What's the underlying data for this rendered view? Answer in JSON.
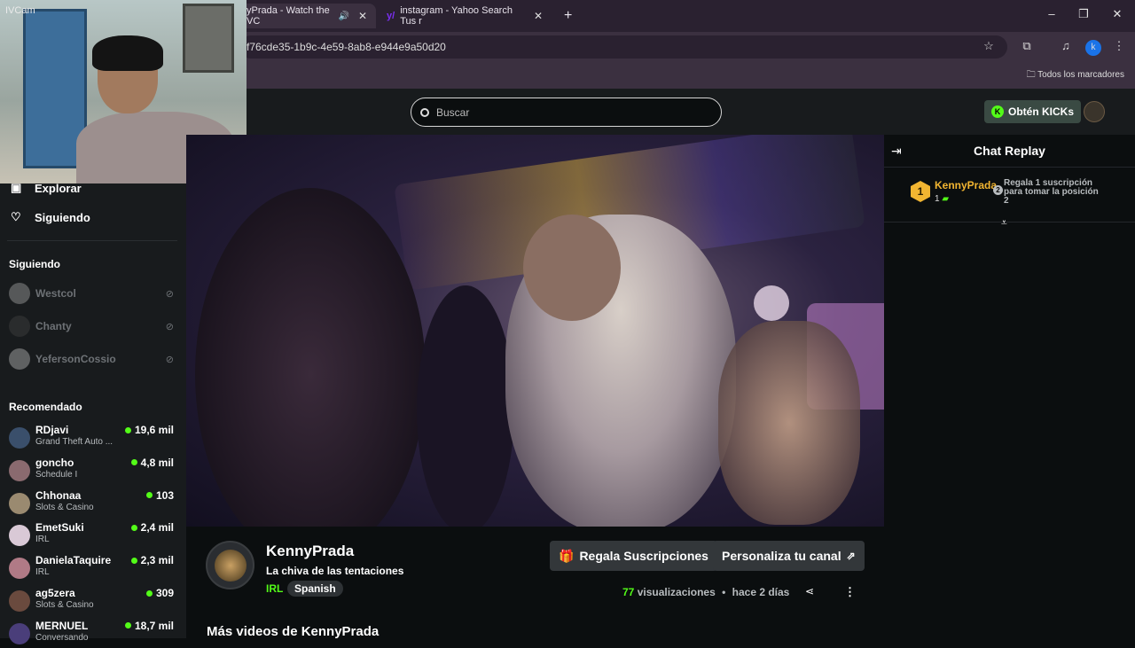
{
  "browser": {
    "tabs": [
      {
        "label": "yPrada - Watch the VC",
        "active": true
      },
      {
        "label": "instagram - Yahoo Search Tus r",
        "active": false
      }
    ],
    "new_tab": "+",
    "url": "f76cde35-1b9c-4e59-8ab8-e944e9a50d20",
    "bookmarks_label": "Todos los marcadores",
    "profile_letter": "k"
  },
  "webcam": {
    "label": "IVCam"
  },
  "header": {
    "search_placeholder": "Buscar",
    "kicks_label": "Obtén KICKs"
  },
  "sidebar": {
    "nav": [
      {
        "label": "Explorar"
      },
      {
        "label": "Siguiendo"
      }
    ],
    "following_title": "Siguiendo",
    "following": [
      {
        "name": "Westcol"
      },
      {
        "name": "Chanty"
      },
      {
        "name": "YefersonCossio"
      }
    ],
    "recommended_title": "Recomendado",
    "recommended": [
      {
        "name": "RDjavi",
        "category": "Grand Theft Auto ...",
        "viewers": "19,6 mil",
        "color": "#3a4f6b"
      },
      {
        "name": "goncho",
        "category": "Schedule I",
        "viewers": "4,8 mil",
        "color": "#8a6a6f"
      },
      {
        "name": "Chhonaa",
        "category": "Slots & Casino",
        "viewers": "103",
        "color": "#9a8a70"
      },
      {
        "name": "EmetSuki",
        "category": "IRL",
        "viewers": "2,4 mil",
        "color": "#d9c9d6"
      },
      {
        "name": "DanielaTaquire",
        "category": "IRL",
        "viewers": "2,3 mil",
        "color": "#b07a86"
      },
      {
        "name": "ag5zera",
        "category": "Slots & Casino",
        "viewers": "309",
        "color": "#6a4a3e"
      },
      {
        "name": "MERNUEL",
        "category": "Conversando",
        "viewers": "18,7 mil",
        "color": "#4a3e7a"
      }
    ]
  },
  "chat": {
    "title": "Chat Replay",
    "top_gifter": {
      "rank": "1",
      "name": "KennyPrada",
      "count": "1"
    },
    "slot": {
      "rank": "2",
      "text": "Regala 1 suscripción para tomar la posición 2"
    }
  },
  "stream": {
    "channel": "KennyPrada",
    "title": "La chiva de las tentaciones",
    "category": "IRL",
    "language": "Spanish",
    "gift_button": "Regala Suscripciones",
    "customize_button": "Personaliza tu canal",
    "views_count": "77",
    "views_label": "visualizaciones",
    "separator": "•",
    "age": "hace 2 días",
    "more_videos": "Más videos de KennyPrada"
  }
}
